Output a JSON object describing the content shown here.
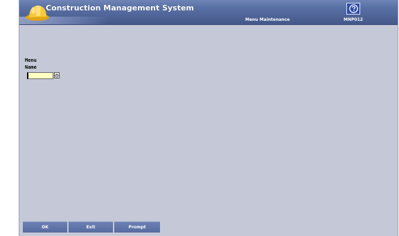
{
  "app": {
    "title": "Construction Management System",
    "screen_name": "Menu Maintenance",
    "screen_code": "MNP012"
  },
  "help": {
    "icon": "help-icon"
  },
  "form": {
    "label_line1": "Menu",
    "label_line2": "Name",
    "menu_name_value": ""
  },
  "actions": {
    "ok_label": "OK",
    "exit_label": "Exit",
    "prompt_label": "Prompt"
  },
  "colors": {
    "background": "#c5c8d6",
    "titlebar": "#5a71a5",
    "input_bg": "#ffffc4",
    "helmet": "#f2c12e"
  }
}
